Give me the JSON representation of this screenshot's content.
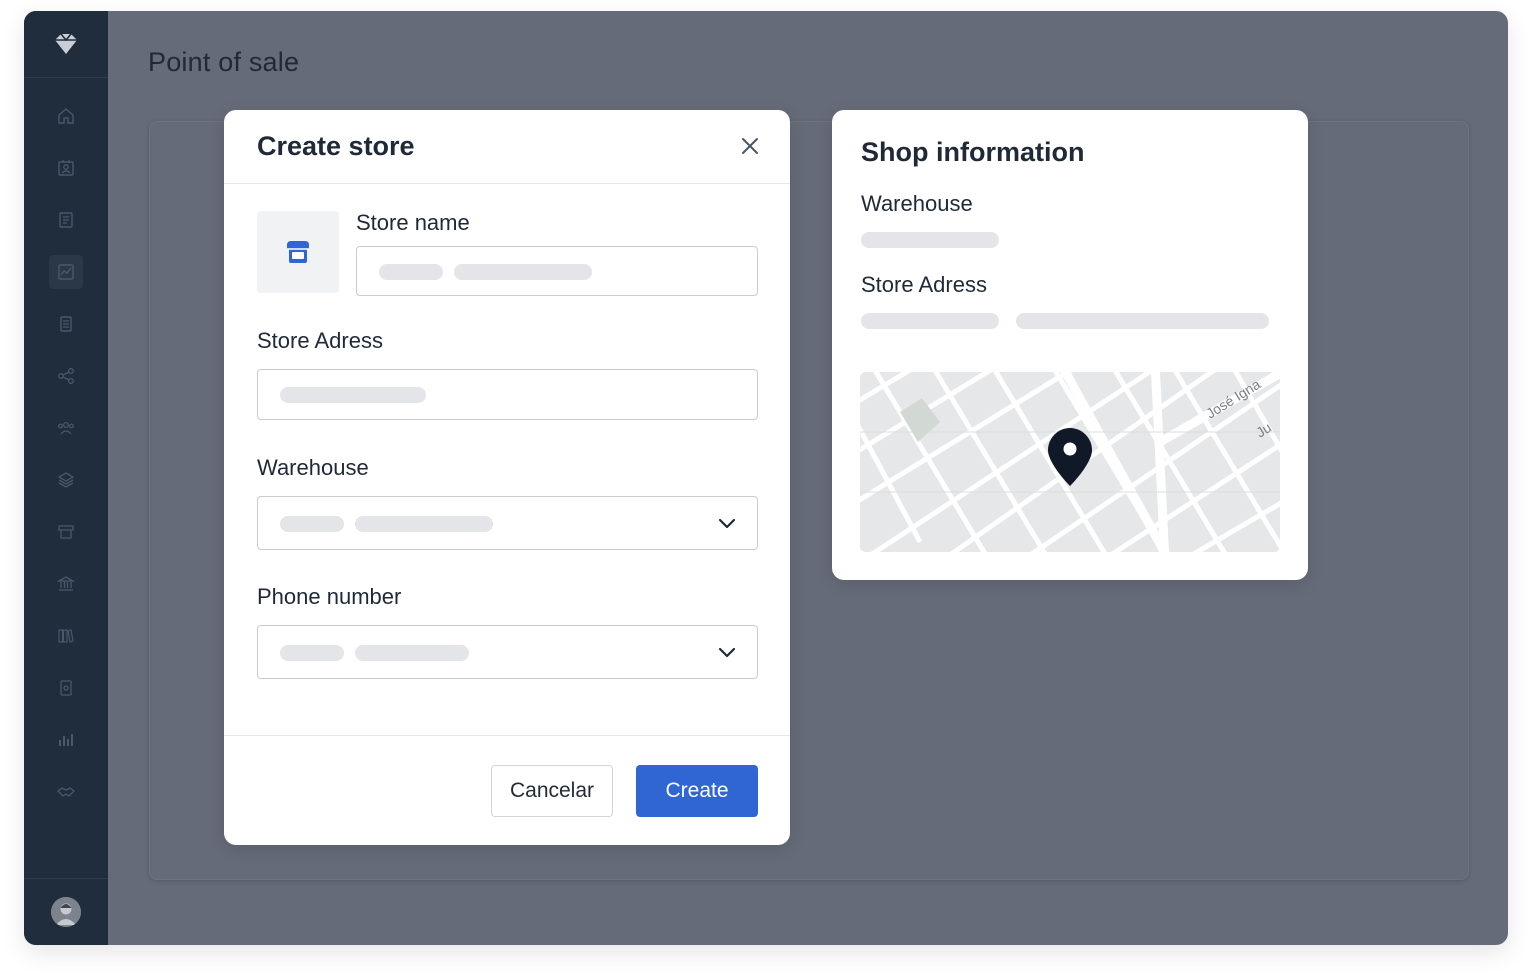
{
  "app": {
    "page_title": "Point of sale"
  },
  "sidebar": {
    "logo_icon": "diamond-logo-icon",
    "items": [
      {
        "name": "home-icon",
        "active": false
      },
      {
        "name": "contacts-icon",
        "active": false
      },
      {
        "name": "invoice-icon",
        "active": false
      },
      {
        "name": "chart-icon",
        "active": true
      },
      {
        "name": "document-icon",
        "active": false
      },
      {
        "name": "share-icon",
        "active": false
      },
      {
        "name": "team-icon",
        "active": false
      },
      {
        "name": "layers-icon",
        "active": false
      },
      {
        "name": "store-icon",
        "active": false
      },
      {
        "name": "bank-icon",
        "active": false
      },
      {
        "name": "books-icon",
        "active": false
      },
      {
        "name": "report-icon",
        "active": false
      },
      {
        "name": "bar-chart-icon",
        "active": false
      },
      {
        "name": "handshake-icon",
        "active": false
      }
    ]
  },
  "modal": {
    "title": "Create store",
    "store_name_label": "Store name",
    "store_address_label": "Store Adress",
    "warehouse_label": "Warehouse",
    "phone_label": "Phone number",
    "cancel_label": "Cancelar",
    "create_label": "Create"
  },
  "shop_info": {
    "title": "Shop information",
    "warehouse_label": "Warehouse",
    "store_address_label": "Store Adress",
    "map_street_label": "José Igna",
    "map_street_label_2": "Ju"
  },
  "colors": {
    "primary": "#2f66d4",
    "sidebar": "#1f2d3d",
    "overlay": "#656b78",
    "skeleton": "#e4e5e8"
  }
}
